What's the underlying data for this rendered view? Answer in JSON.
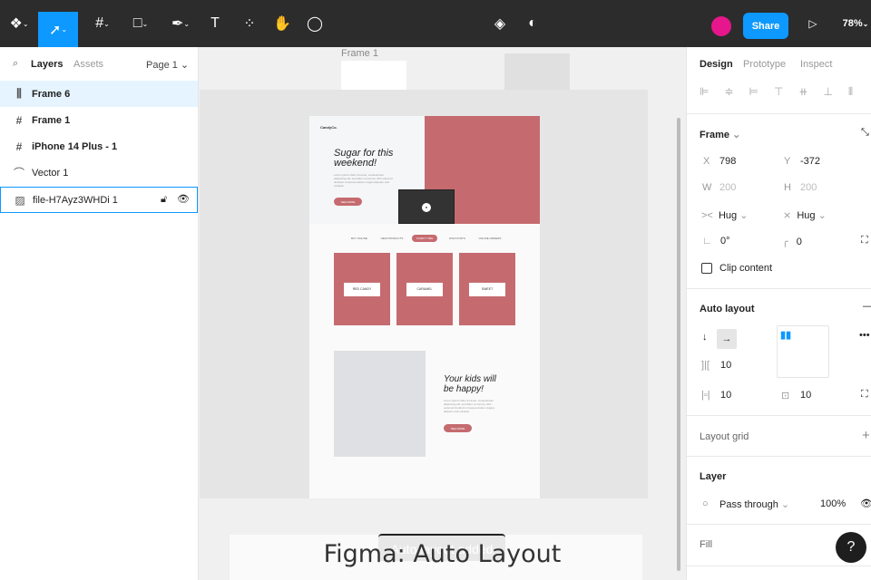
{
  "toolbar": {
    "share": "Share",
    "zoom": "78%"
  },
  "layers_panel": {
    "tabs": [
      "Layers",
      "Assets"
    ],
    "page": "Page 1",
    "items": [
      {
        "name": "Frame 6",
        "icon": "auto-layout-icon"
      },
      {
        "name": "Frame 1",
        "icon": "frame-icon"
      },
      {
        "name": "iPhone 14 Plus - 1",
        "icon": "frame-icon"
      },
      {
        "name": "Vector 1",
        "icon": "vector-icon"
      },
      {
        "name": "file-H7Ayz3WHDi 1",
        "icon": "image-icon"
      }
    ]
  },
  "canvas": {
    "frame_label": "Frame 1",
    "brand": "CandyCo.",
    "hero_title": "Sugar for this weekend!",
    "hero_text": "Lorem ipsum dolor sit amet, consectetuer adipiscing elit, sed diam nonummy nibh euismod tincidunt ut laoreet dolore magna aliquam erat volutpat.",
    "see_more": "SEE MORE",
    "nav": [
      "BUY ONLINE",
      "NEW PRODUCTS",
      "CANDY TIME",
      "DISCOUNTS",
      "ONLINE ORDERS"
    ],
    "cards": [
      "RED CANDY",
      "CARAMEL",
      "SWEET"
    ],
    "kids_title": "Your kids will be happy!",
    "kids_text": "Lorem ipsum dolor sit amet, consectetuer adipiscing elit, sed diam nonummy nibh euismod tincidunt ut laoreet dolore magna aliquam erat volutpat.",
    "toast": "Auto layout added",
    "accent": "#c56b70"
  },
  "design_panel": {
    "tabs": [
      "Design",
      "Prototype",
      "Inspect"
    ],
    "frame": "Frame",
    "x_label": "X",
    "x": "798",
    "y_label": "Y",
    "y": "-372",
    "w_label": "W",
    "w": "200",
    "h_label": "H",
    "h": "200",
    "hug_w": "Hug",
    "hug_h": "Hug",
    "rotation": "0°",
    "radius": "0",
    "clip": "Clip content",
    "auto_layout": "Auto layout",
    "gap": "10",
    "pad_h": "10",
    "pad_v": "10",
    "layout_grid": "Layout grid",
    "layer": "Layer",
    "blend": "Pass through",
    "opacity": "100%",
    "fill": "Fill"
  },
  "caption": "Figma: Auto Layout",
  "help": "?"
}
